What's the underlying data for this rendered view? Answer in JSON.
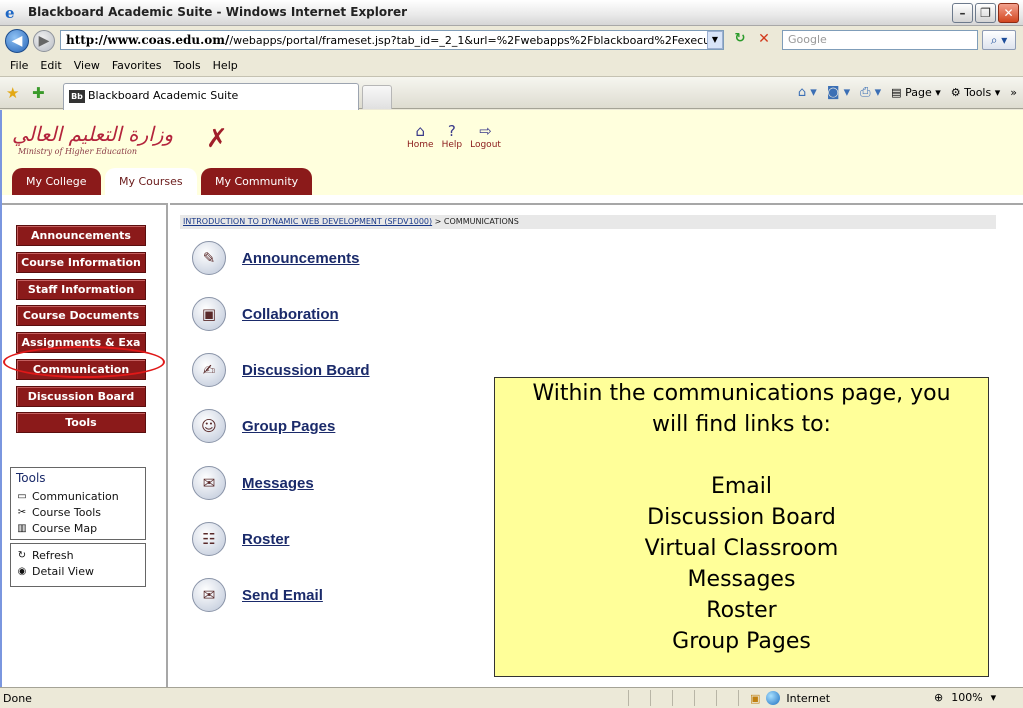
{
  "window": {
    "title": "Blackboard Academic Suite - Windows Internet Explorer"
  },
  "addressbar": {
    "url_bold": "http://www.coas.edu.om/",
    "url_rest": "/webapps/portal/frameset.jsp?tab_id=_2_1&url=%2Fwebapps%2Fblackboard%2Fexecute%2Flaunc",
    "search_placeholder": "Google"
  },
  "menu": [
    "File",
    "Edit",
    "View",
    "Favorites",
    "Tools",
    "Help"
  ],
  "browser_tab": {
    "badge": "Bb",
    "label": "Blackboard Academic Suite"
  },
  "commandbar": {
    "page_label": "Page",
    "tools_label": "Tools"
  },
  "header": {
    "logo_arabic": "وزارة التعليم العالي",
    "logo_english": "Ministry of Higher Education",
    "toplinks": [
      "Home",
      "Help",
      "Logout"
    ],
    "tabs": [
      "My College",
      "My Courses",
      "My Community"
    ]
  },
  "leftnav": {
    "buttons": [
      "Announcements",
      "Course Information",
      "Staff Information",
      "Course Documents",
      "Assignments & Exa",
      "Communication",
      "Discussion Board",
      "Tools"
    ],
    "tools_box": {
      "heading": "Tools",
      "items": [
        "Communication",
        "Course Tools",
        "Course Map"
      ]
    },
    "actions": [
      "Refresh",
      "Detail View"
    ]
  },
  "content": {
    "breadcrumb_link": "INTRODUCTION TO DYNAMIC WEB DEVELOPMENT (SFDV1000)",
    "breadcrumb_current": "> COMMUNICATIONS",
    "tools": [
      "Announcements",
      "Collaboration",
      "Discussion Board",
      "Group Pages",
      "Messages",
      "Roster",
      "Send Email"
    ]
  },
  "callout": {
    "line1": "Within the communications page, you",
    "line2": "will find links to:",
    "items": [
      "Email",
      "Discussion Board",
      "Virtual Classroom",
      "Messages",
      "Roster",
      "Group Pages"
    ]
  },
  "statusbar": {
    "status": "Done",
    "zone": "Internet",
    "zoom": "100%"
  }
}
